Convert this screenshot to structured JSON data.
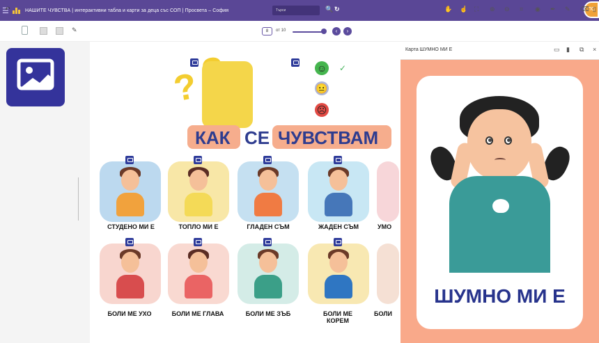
{
  "header": {
    "title": "НАШИТЕ ЧУВСТВА | интерактивни табла и карти за деца със СОП | Просвета – София",
    "search_placeholder": "Търси",
    "avatar": "ПС"
  },
  "toolbar": {
    "current_page": "8",
    "page_total": "от 10"
  },
  "main": {
    "title_words": [
      "КАК",
      "СЕ",
      "ЧУВСТВАМ"
    ],
    "cards": [
      {
        "label": "СТУДЕНО МИ Е",
        "color": "#bcd9ef"
      },
      {
        "label": "ТОПЛО МИ Е",
        "color": "#f8e7a7"
      },
      {
        "label": "ГЛАДЕН СЪМ",
        "color": "#c5e0f1"
      },
      {
        "label": "ЖАДЕН СЪМ",
        "color": "#c8e7f4"
      },
      {
        "label": "УМО",
        "color": "#f7d6d9"
      },
      {
        "label": "БОЛИ МЕ УХО",
        "color": "#f8d6cf"
      },
      {
        "label": "БОЛИ МЕ ГЛАВА",
        "color": "#f9d9d1"
      },
      {
        "label": "БОЛИ МЕ ЗЪБ",
        "color": "#d4ece7"
      },
      {
        "label": "БОЛИ МЕ КОРЕМ",
        "color": "#f8e8b2"
      },
      {
        "label": "БОЛИ",
        "color": "#f5e0d4"
      }
    ]
  },
  "panel": {
    "title": "Карта ШУМНО МИ Е",
    "card_text": "ШУМНО МИ Е"
  }
}
